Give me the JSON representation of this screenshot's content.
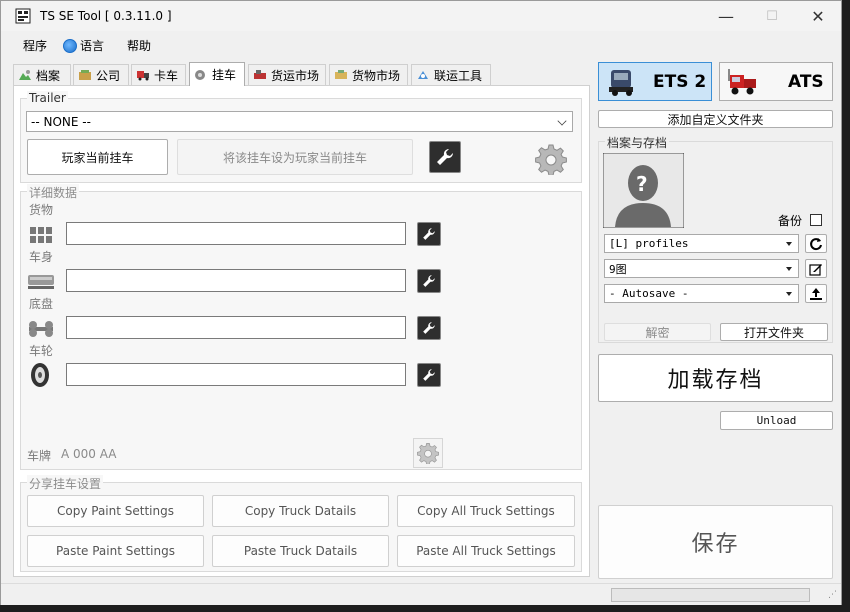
{
  "window": {
    "title": "TS SE Tool [ 0.3.11.0 ]",
    "minimize": "—",
    "maximize": "☐",
    "close": "✕"
  },
  "menu": {
    "program": "程序",
    "language": "语言",
    "help": "帮助"
  },
  "tabs": [
    {
      "label": "档案",
      "icon": "profile-icon"
    },
    {
      "label": "公司",
      "icon": "company-icon"
    },
    {
      "label": "卡车",
      "icon": "truck-icon"
    },
    {
      "label": "挂车",
      "icon": "trailer-icon"
    },
    {
      "label": "货运市场",
      "icon": "freight-market-icon"
    },
    {
      "label": "货物市场",
      "icon": "cargo-market-icon"
    },
    {
      "label": "联运工具",
      "icon": "convoy-tools-icon"
    }
  ],
  "trailer": {
    "group_label": "Trailer",
    "select_value": "-- NONE --",
    "player_trailer_btn": "玩家当前挂车",
    "set_player_trailer_btn": "将该挂车设为玩家当前挂车"
  },
  "details": {
    "group_label": "详细数据",
    "rows": [
      {
        "label": "货物",
        "icon": "cargo-icon",
        "value": ""
      },
      {
        "label": "车身",
        "icon": "body-icon",
        "value": ""
      },
      {
        "label": "底盘",
        "icon": "chassis-icon",
        "value": ""
      },
      {
        "label": "车轮",
        "icon": "wheels-icon",
        "value": ""
      }
    ],
    "plate_label": "车牌",
    "plate_value": "A 000 AA"
  },
  "share": {
    "group_label": "分享挂车设置",
    "copy_paint": "Copy Paint Settings",
    "copy_truck": "Copy Truck Datails",
    "copy_all": "Copy All Truck Settings",
    "paste_paint": "Paste Paint Settings",
    "paste_truck": "Paste Truck Datails",
    "paste_all": "Paste All Truck Settings"
  },
  "right": {
    "ets2_label": "ETS 2",
    "ats_label": "ATS",
    "add_custom_folder": "添加自定义文件夹",
    "profiles_group_label": "档案与存档",
    "backup_label": "备份",
    "profiles_dir": "[L] profiles",
    "profile": "9图",
    "save": "- Autosave -",
    "decrypt_btn": "解密",
    "open_folder_btn": "打开文件夹",
    "load_save_btn": "加载存档",
    "unload_btn": "Unload",
    "save_btn": "保存"
  },
  "colors": {
    "accent": "#cce4f7",
    "accent_border": "#3a8fd6",
    "icon_btn": "#2e2e2e"
  }
}
